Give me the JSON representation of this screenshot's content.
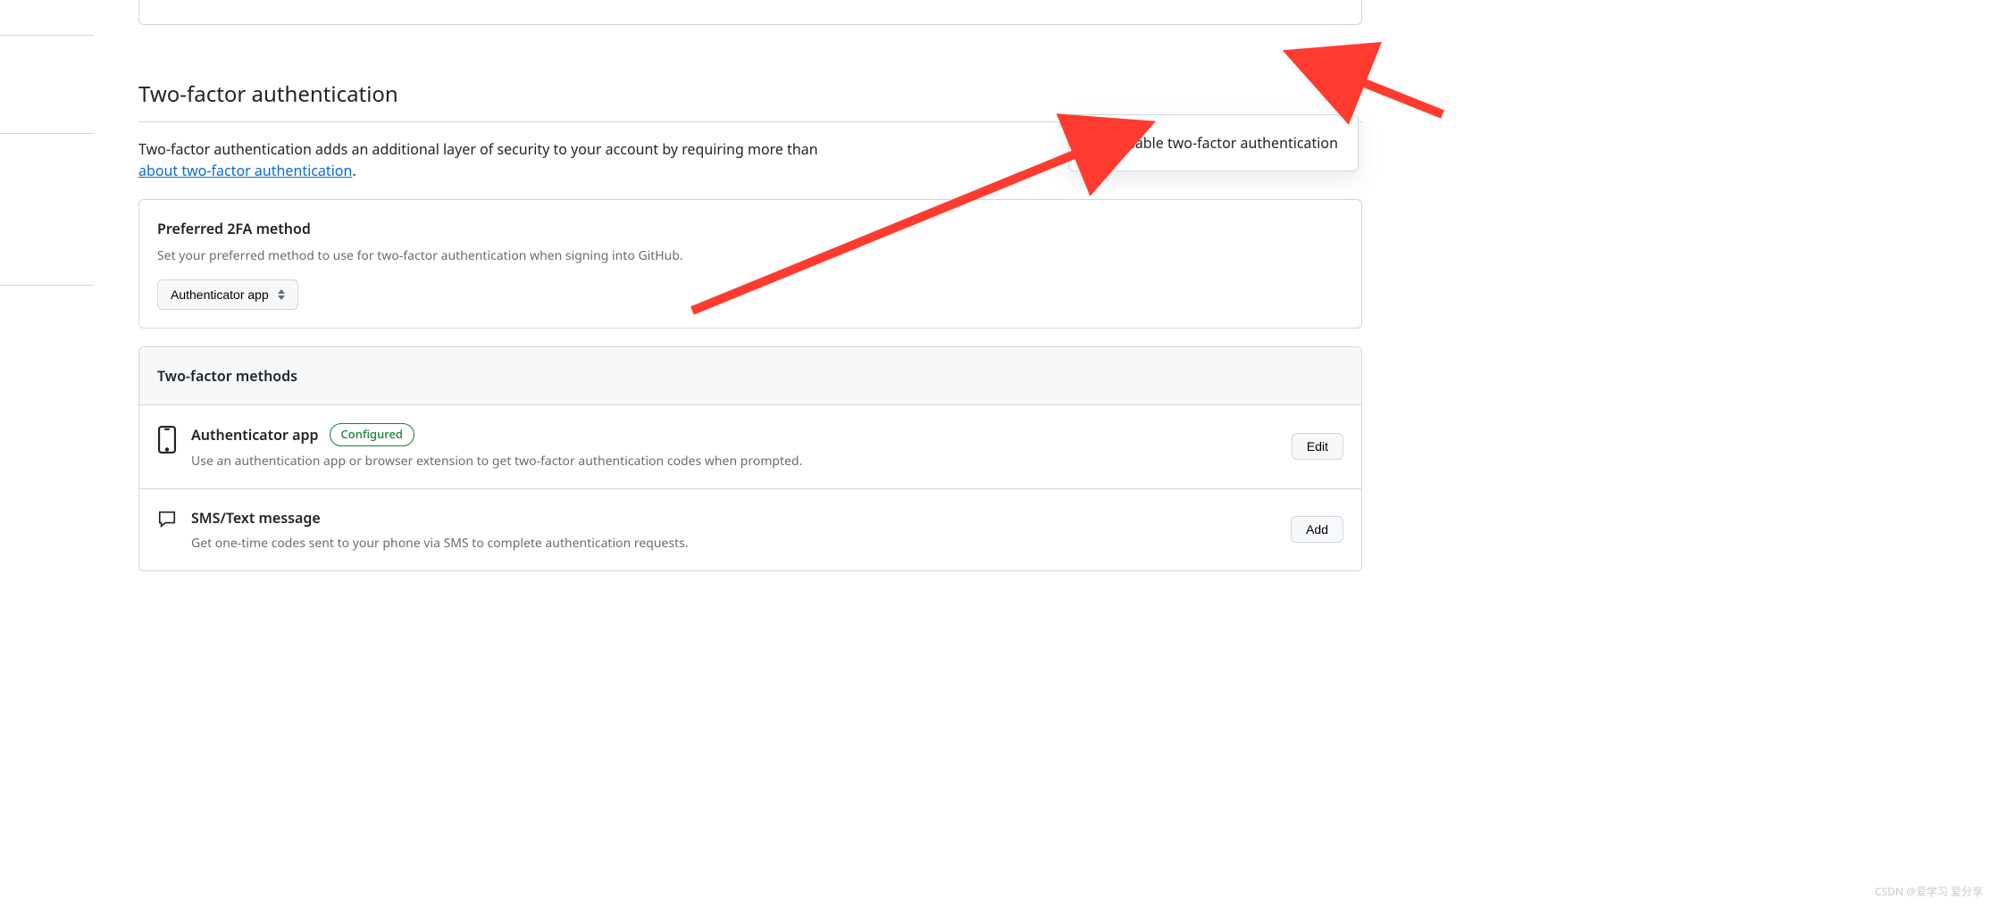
{
  "section": {
    "title": "Two-factor authentication",
    "intro_text": "Two-factor authentication adds an additional layer of security to your account by requiring more than ",
    "intro_link": "about two-factor authentication",
    "intro_end": "."
  },
  "dropdown": {
    "disable_label": "Disable two-factor authentication"
  },
  "preferred": {
    "title": "Preferred 2FA method",
    "subtitle": "Set your preferred method to use for two-factor authentication when signing into GitHub.",
    "selected": "Authenticator app"
  },
  "methods": {
    "header": "Two-factor methods",
    "items": [
      {
        "title": "Authenticator app",
        "badge": "Configured",
        "desc": "Use an authentication app or browser extension to get two-factor authentication codes when prompted.",
        "action": "Edit"
      },
      {
        "title": "SMS/Text message",
        "badge": "",
        "desc": "Get one-time codes sent to your phone via SMS to complete authentication requests.",
        "action": "Add"
      }
    ]
  },
  "watermark": "CSDN @爱学习 爱分享"
}
